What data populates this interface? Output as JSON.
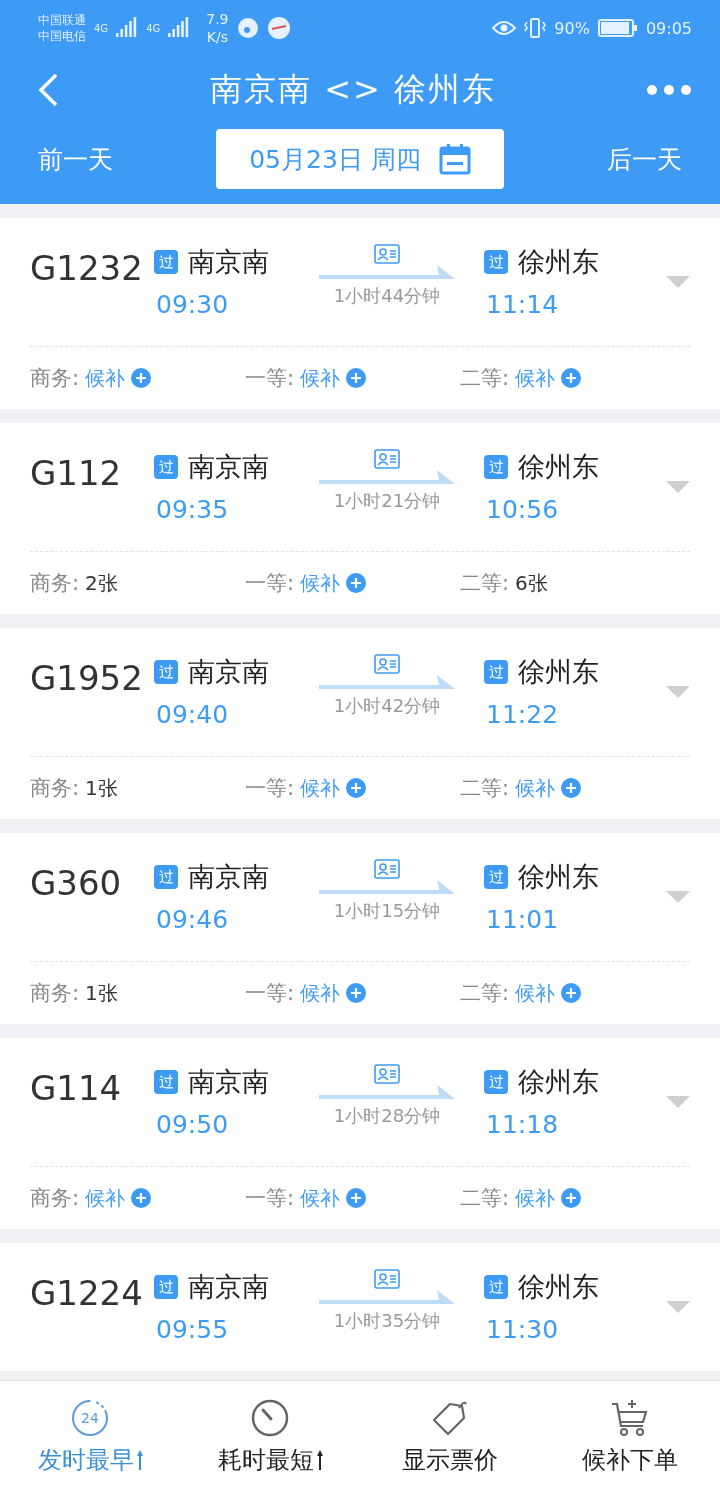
{
  "status_bar": {
    "carriers": [
      "中国联通",
      "中国电信"
    ],
    "network": [
      "4G",
      "4G"
    ],
    "speed": "7.9",
    "speed_unit": "K/s",
    "battery": "90%",
    "time": "09:05"
  },
  "header": {
    "title": "南京南 <> 徐州东",
    "prev_day": "前一天",
    "date": "05月23日 周四",
    "next_day": "后一天"
  },
  "trains": [
    {
      "number": "G1232",
      "from_badge": "过",
      "from": "南京南",
      "depart": "09:30",
      "duration": "1小时44分钟",
      "to_badge": "过",
      "to": "徐州东",
      "arrive": "11:14",
      "seats": [
        {
          "label": "商务:",
          "kind": "waitlist",
          "value": "候补"
        },
        {
          "label": "一等:",
          "kind": "waitlist",
          "value": "候补"
        },
        {
          "label": "二等:",
          "kind": "waitlist",
          "value": "候补"
        }
      ]
    },
    {
      "number": "G112",
      "from_badge": "过",
      "from": "南京南",
      "depart": "09:35",
      "duration": "1小时21分钟",
      "to_badge": "过",
      "to": "徐州东",
      "arrive": "10:56",
      "seats": [
        {
          "label": "商务:",
          "kind": "count",
          "value": "2张"
        },
        {
          "label": "一等:",
          "kind": "waitlist",
          "value": "候补"
        },
        {
          "label": "二等:",
          "kind": "count",
          "value": "6张"
        }
      ]
    },
    {
      "number": "G1952",
      "from_badge": "过",
      "from": "南京南",
      "depart": "09:40",
      "duration": "1小时42分钟",
      "to_badge": "过",
      "to": "徐州东",
      "arrive": "11:22",
      "seats": [
        {
          "label": "商务:",
          "kind": "count",
          "value": "1张"
        },
        {
          "label": "一等:",
          "kind": "waitlist",
          "value": "候补"
        },
        {
          "label": "二等:",
          "kind": "waitlist",
          "value": "候补"
        }
      ]
    },
    {
      "number": "G360",
      "from_badge": "过",
      "from": "南京南",
      "depart": "09:46",
      "duration": "1小时15分钟",
      "to_badge": "过",
      "to": "徐州东",
      "arrive": "11:01",
      "seats": [
        {
          "label": "商务:",
          "kind": "count",
          "value": "1张"
        },
        {
          "label": "一等:",
          "kind": "waitlist",
          "value": "候补"
        },
        {
          "label": "二等:",
          "kind": "waitlist",
          "value": "候补"
        }
      ]
    },
    {
      "number": "G114",
      "from_badge": "过",
      "from": "南京南",
      "depart": "09:50",
      "duration": "1小时28分钟",
      "to_badge": "过",
      "to": "徐州东",
      "arrive": "11:18",
      "seats": [
        {
          "label": "商务:",
          "kind": "waitlist",
          "value": "候补"
        },
        {
          "label": "一等:",
          "kind": "waitlist",
          "value": "候补"
        },
        {
          "label": "二等:",
          "kind": "waitlist",
          "value": "候补"
        }
      ]
    },
    {
      "number": "G1224",
      "from_badge": "过",
      "from": "南京南",
      "depart": "09:55",
      "duration": "1小时35分钟",
      "to_badge": "过",
      "to": "徐州东",
      "arrive": "11:30"
    }
  ],
  "bottom_bar": [
    {
      "kind": "clock24",
      "icon_text": "24",
      "label": "发时最早",
      "sortable": true,
      "selected": true
    },
    {
      "kind": "timer",
      "label": "耗时最短",
      "sortable": true,
      "selected": false
    },
    {
      "kind": "tag",
      "label": "显示票价",
      "sortable": false,
      "selected": false
    },
    {
      "kind": "cart",
      "label": "候补下单",
      "sortable": false,
      "selected": false
    }
  ]
}
